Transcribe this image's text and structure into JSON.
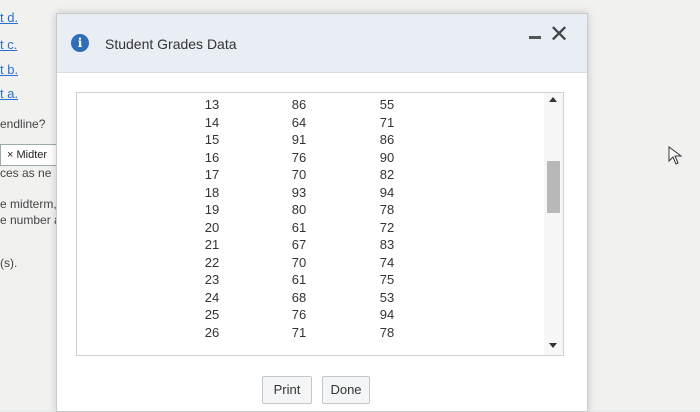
{
  "background": {
    "links": [
      "t d.",
      "t c.",
      "t b.",
      "t a."
    ],
    "texts": [
      "endline?",
      "ces as ne",
      "e midterm,",
      "e number a",
      "(s)."
    ],
    "checkbox_label": "× Midter"
  },
  "dialog": {
    "title": "Student Grades Data",
    "close_glyph": "✕",
    "rows": [
      [
        "13",
        "86",
        "55"
      ],
      [
        "14",
        "64",
        "71"
      ],
      [
        "15",
        "91",
        "86"
      ],
      [
        "16",
        "76",
        "90"
      ],
      [
        "17",
        "70",
        "82"
      ],
      [
        "18",
        "93",
        "94"
      ],
      [
        "19",
        "80",
        "78"
      ],
      [
        "20",
        "61",
        "72"
      ],
      [
        "21",
        "67",
        "83"
      ],
      [
        "22",
        "70",
        "74"
      ],
      [
        "23",
        "61",
        "75"
      ],
      [
        "24",
        "68",
        "53"
      ],
      [
        "25",
        "76",
        "94"
      ],
      [
        "26",
        "71",
        "78"
      ]
    ],
    "buttons": {
      "print": "Print",
      "done": "Done"
    }
  },
  "icons": {
    "info": "info-icon",
    "minimize": "minimize-icon",
    "close": "close-icon",
    "cursor": "mouse-cursor-icon"
  },
  "colors": {
    "header_bg": "#e9eef4",
    "info_icon": "#2f6fb8",
    "link": "#2a6fd1"
  }
}
